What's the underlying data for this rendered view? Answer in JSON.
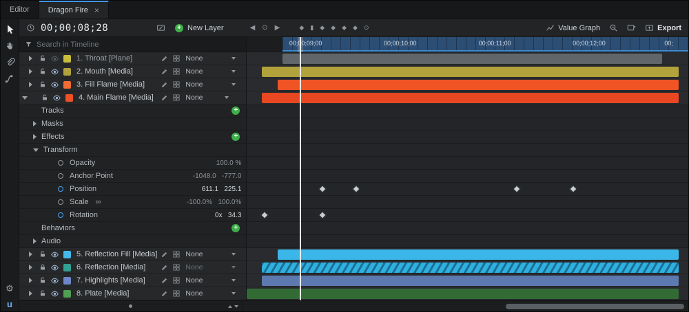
{
  "tabs": [
    {
      "label": "Editor"
    },
    {
      "label": "Dragon Fire",
      "close": "×"
    }
  ],
  "icons": {
    "gear": "⚙",
    "logo": "u",
    "prev_key": "◀",
    "record": "⊙",
    "next_key": "▶",
    "add": "+",
    "link": "∞"
  },
  "transport": {
    "timecode": "00;00;08;28",
    "new_layer_label": "New Layer",
    "toggles": [
      "◆",
      "▮",
      "◆",
      "◆",
      "◆",
      "◆",
      "⊙"
    ]
  },
  "header": {
    "value_graph_label": "Value Graph",
    "export_label": "Export"
  },
  "search": {
    "placeholder": "Search in Timeline"
  },
  "ruler": {
    "labels": [
      {
        "text": "00;00;09;00",
        "pos": 9.6
      },
      {
        "text": "00;00;10;00",
        "pos": 31.0
      },
      {
        "text": "00;00;11;00",
        "pos": 52.5
      },
      {
        "text": "00;00;12;00",
        "pos": 73.8
      },
      {
        "text": "00;",
        "pos": 94.6
      }
    ]
  },
  "playhead": {
    "pos": 12.0,
    "timecode": "00;00;08;28"
  },
  "layers": [
    {
      "label": "1. Throat [Plane]",
      "color": "#c8bc3d",
      "blend": "None",
      "eye": "off",
      "lock": "open",
      "bar": {
        "start": 8.0,
        "end": 94.1,
        "color": "#60666a",
        "hatch": false
      }
    },
    {
      "label": "2. Mouth [Media]",
      "color": "#b3a33c",
      "blend": "None",
      "eye": "on",
      "lock": "open",
      "bar": {
        "start": 3.4,
        "end": 97.8,
        "color": "#b1a23c",
        "hatch": false
      }
    },
    {
      "label": "3. Fill Flame [Media]",
      "color": "#ef6c35",
      "blend": "None",
      "eye": "on",
      "lock": "open",
      "bar": {
        "start": 6.9,
        "end": 97.8,
        "color": "#f05425",
        "hatch": false
      }
    },
    {
      "label": "4. Main Flame [Media]",
      "color": "#ed5226",
      "blend": "None",
      "eye": "on",
      "lock": "open",
      "bar": {
        "start": 3.4,
        "end": 97.8,
        "color": "#e84722",
        "hatch": false
      }
    },
    {
      "label": "5. Reflection Fill [Media]",
      "color": "#44b9e9",
      "blend": "None",
      "eye": "on",
      "lock": "open",
      "bar": {
        "start": 6.9,
        "end": 97.8,
        "color": "#3ab7e8",
        "hatch": false
      }
    },
    {
      "label": "6. Reflection [Media]",
      "color": "#2fa292",
      "blend": "None",
      "eye": "on",
      "lock": "closed",
      "blend_dim": true,
      "bar": {
        "start": 3.4,
        "end": 97.8,
        "color": "#2fb0e0",
        "hatch": true
      }
    },
    {
      "label": "7. Highlights [Media]",
      "color": "#6e87c8",
      "blend": "None",
      "eye": "on",
      "lock": "open",
      "bar": {
        "start": 3.4,
        "end": 97.8,
        "color": "#5d7ab0",
        "hatch": false
      }
    },
    {
      "label": "8. Plate [Media]",
      "color": "#4f9e51",
      "blend": "None",
      "eye": "on",
      "lock": "open",
      "bar": {
        "start": 0.0,
        "end": 97.8,
        "color": "#336b35",
        "hatch": false
      }
    }
  ],
  "outline": {
    "tracks": {
      "label": "Tracks"
    },
    "masks": {
      "label": "Masks"
    },
    "effects": {
      "label": "Effects"
    },
    "transform": {
      "label": "Transform"
    },
    "props": [
      {
        "label": "Opacity",
        "value": "100.0 %"
      },
      {
        "label": "Anchor Point",
        "value": "-1048.0   -777.0"
      },
      {
        "label": "Position",
        "value": "611.1   225.1",
        "keyed": true,
        "keyframes": [
          17.1,
          24.8,
          61.1,
          73.9
        ]
      },
      {
        "label": "Scale",
        "value": "-100.0%   100.0%",
        "link": true
      },
      {
        "label": "Rotation",
        "value": "0x   34.3",
        "keyed": true,
        "keyframes": [
          4.0,
          17.1
        ]
      }
    ],
    "behaviors": {
      "label": "Behaviors"
    },
    "audio": {
      "label": "Audio"
    }
  }
}
